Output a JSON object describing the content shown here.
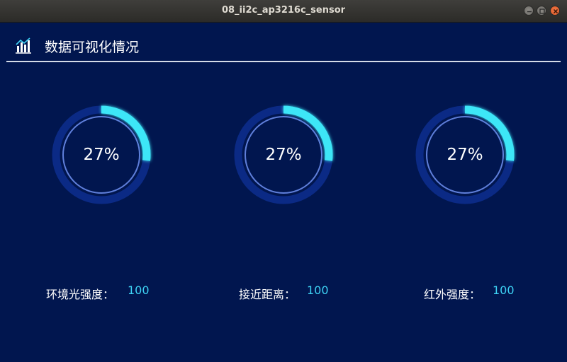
{
  "window": {
    "title": "08_ii2c_ap3216c_sensor"
  },
  "header": {
    "title": "数据可视化情况",
    "icon": "chart-icon"
  },
  "colors": {
    "background": "#01164f",
    "ring_track": "#0b2a85",
    "ring_progress": "#3ee6f7",
    "ring_inner": "#5f7fdb",
    "value_text": "#3ed3f5"
  },
  "gauges": [
    {
      "percent": 27,
      "label": "27%"
    },
    {
      "percent": 27,
      "label": "27%"
    },
    {
      "percent": 27,
      "label": "27%"
    }
  ],
  "readings": [
    {
      "label": "环境光强度：",
      "value": "100"
    },
    {
      "label": "接近距离：",
      "value": "100"
    },
    {
      "label": "红外强度：",
      "value": "100"
    }
  ]
}
